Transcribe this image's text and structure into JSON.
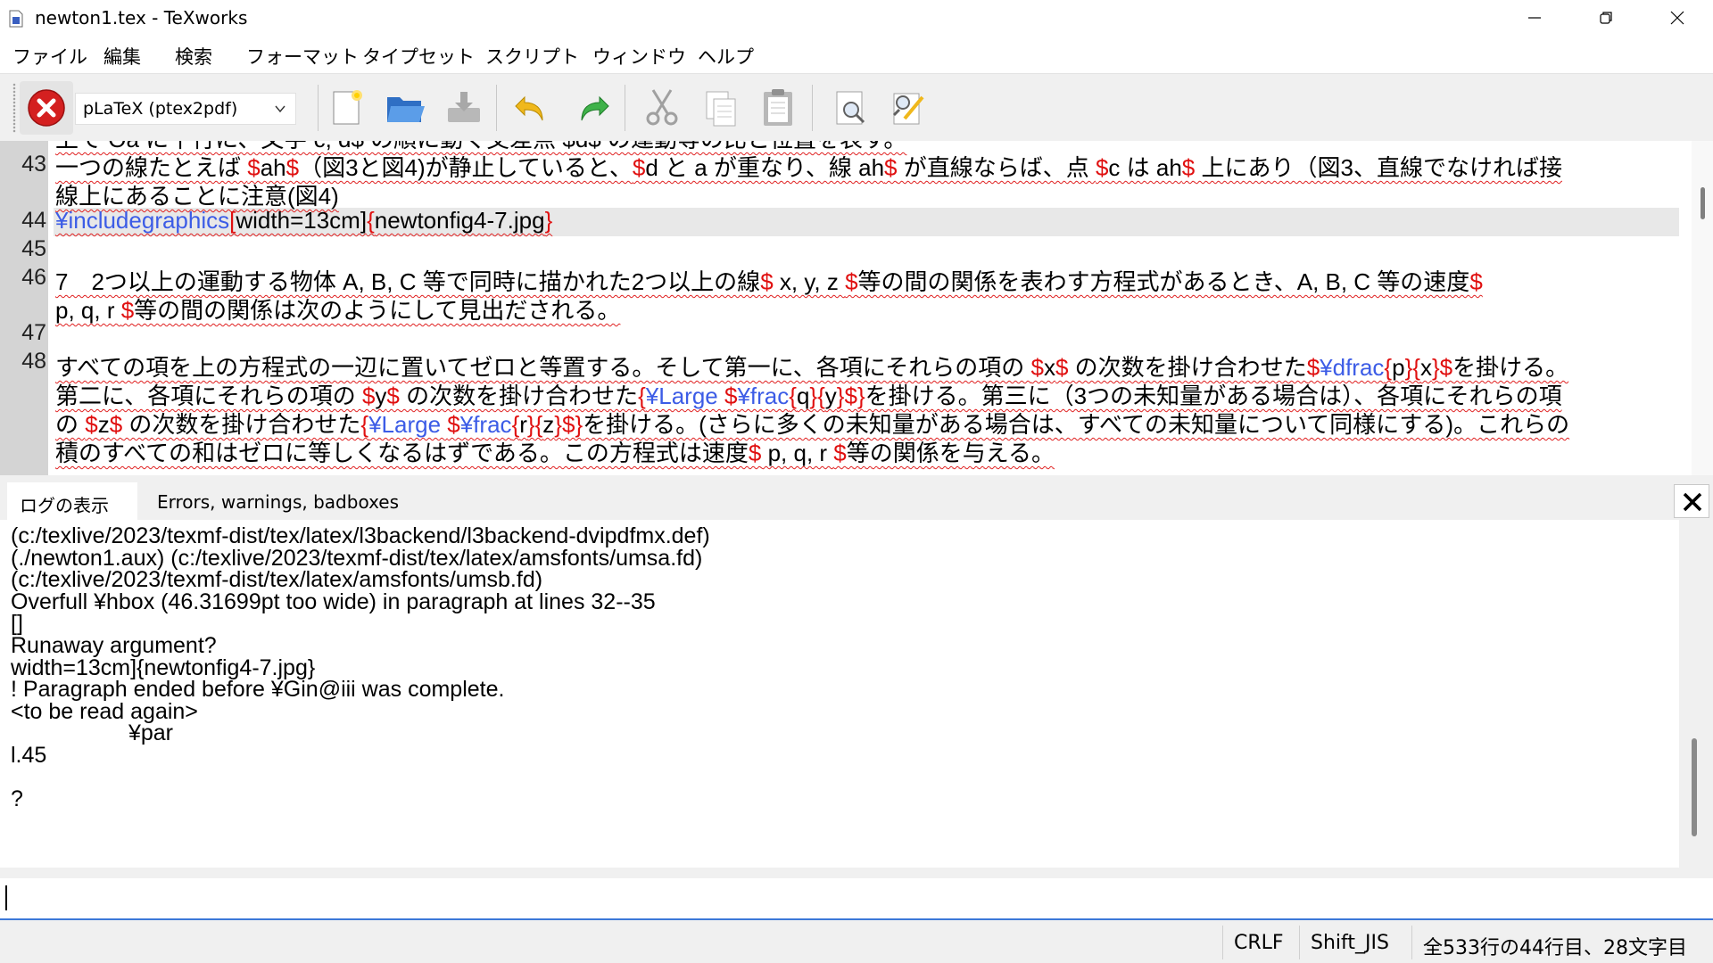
{
  "window": {
    "title": "newton1.tex - TeXworks"
  },
  "menu": [
    "ファイル",
    "編集",
    "検索",
    "フォーマット",
    "タイプセット",
    "スクリプト",
    "ウィンドウ",
    "ヘルプ"
  ],
  "toolbar": {
    "engine": "pLaTeX (ptex2pdf)",
    "icons": [
      "stop-typeset-icon",
      "new-document-icon",
      "open-folder-icon",
      "save-icon",
      "undo-icon",
      "redo-icon",
      "cut-icon",
      "copy-icon",
      "paste-icon",
      "find-icon",
      "replace-icon"
    ]
  },
  "editor": {
    "clipped_line": "上で Oa に平行に、文字 c, d$ の順に動く交差点 $d$ の運動等の比と位置を表す。",
    "line_numbers": [
      "43",
      "",
      "44",
      "45",
      "46",
      "",
      "47",
      "48",
      "",
      "",
      ""
    ],
    "lines": [
      [
        {
          "t": "一つの線たとえば ",
          "c": "n"
        },
        {
          "t": "$",
          "c": "r"
        },
        {
          "t": "ah",
          "c": "n"
        },
        {
          "t": "$",
          "c": "r"
        },
        {
          "t": "（図3と図4)が静止していると、",
          "c": "n"
        },
        {
          "t": "$",
          "c": "r"
        },
        {
          "t": "d と a が重なり、線 ah",
          "c": "n"
        },
        {
          "t": "$",
          "c": "r"
        },
        {
          "t": " が直線ならば、点 ",
          "c": "n"
        },
        {
          "t": "$",
          "c": "r"
        },
        {
          "t": "c は ah",
          "c": "n"
        },
        {
          "t": "$",
          "c": "r"
        },
        {
          "t": " 上にあり（図3、直線でなければ接",
          "c": "n"
        }
      ],
      [
        {
          "t": "線上にあることに注意(図4)",
          "c": "n"
        }
      ],
      [
        {
          "t": "¥includegraphics",
          "c": "b"
        },
        {
          "t": "[",
          "c": "r"
        },
        {
          "t": "width=13cm]",
          "c": "n"
        },
        {
          "t": "{",
          "c": "r"
        },
        {
          "t": "newtonfig4-7.jpg",
          "c": "n"
        },
        {
          "t": "}",
          "c": "r"
        }
      ],
      [],
      [
        {
          "t": "7　2つ以上の運動する物体 A, B, C 等で同時に描かれた2つ以上の線",
          "c": "n"
        },
        {
          "t": "$",
          "c": "r"
        },
        {
          "t": " x, y, z ",
          "c": "n"
        },
        {
          "t": "$",
          "c": "r"
        },
        {
          "t": "等の間の関係を表わす方程式があるとき、A, B, C 等の速度",
          "c": "n"
        },
        {
          "t": "$",
          "c": "r"
        }
      ],
      [
        {
          "t": "p, q, r ",
          "c": "n"
        },
        {
          "t": "$",
          "c": "r"
        },
        {
          "t": "等の間の関係は次のようにして見出だされる。",
          "c": "n"
        }
      ],
      [],
      [
        {
          "t": "すべての項を上の方程式の一辺に置いてゼロと等置する。そして第一に、各項にそれらの項の ",
          "c": "n"
        },
        {
          "t": "$",
          "c": "r"
        },
        {
          "t": "x",
          "c": "n"
        },
        {
          "t": "$",
          "c": "r"
        },
        {
          "t": " の次数を掛け合わせた",
          "c": "n"
        },
        {
          "t": "$",
          "c": "r"
        },
        {
          "t": "¥dfrac",
          "c": "b"
        },
        {
          "t": "{",
          "c": "r"
        },
        {
          "t": "p",
          "c": "n"
        },
        {
          "t": "}{",
          "c": "r"
        },
        {
          "t": "x",
          "c": "n"
        },
        {
          "t": "}",
          "c": "r"
        },
        {
          "t": "$",
          "c": "r"
        },
        {
          "t": "を掛ける。",
          "c": "n"
        }
      ],
      [
        {
          "t": "第二に、各項にそれらの項の ",
          "c": "n"
        },
        {
          "t": "$",
          "c": "r"
        },
        {
          "t": "y",
          "c": "n"
        },
        {
          "t": "$",
          "c": "r"
        },
        {
          "t": " の次数を掛け合わせた",
          "c": "n"
        },
        {
          "t": "{",
          "c": "r"
        },
        {
          "t": "¥Large ",
          "c": "b"
        },
        {
          "t": "$",
          "c": "r"
        },
        {
          "t": "¥frac",
          "c": "b"
        },
        {
          "t": "{",
          "c": "r"
        },
        {
          "t": "q",
          "c": "n"
        },
        {
          "t": "}{",
          "c": "r"
        },
        {
          "t": "y",
          "c": "n"
        },
        {
          "t": "}",
          "c": "r"
        },
        {
          "t": "$}",
          "c": "r"
        },
        {
          "t": "を掛ける。第三に（3つの未知量がある場合は）、各項にそれらの項",
          "c": "n"
        }
      ],
      [
        {
          "t": "の ",
          "c": "n"
        },
        {
          "t": "$",
          "c": "r"
        },
        {
          "t": "z",
          "c": "n"
        },
        {
          "t": "$",
          "c": "r"
        },
        {
          "t": " の次数を掛け合わせた",
          "c": "n"
        },
        {
          "t": "{",
          "c": "r"
        },
        {
          "t": "¥Large ",
          "c": "b"
        },
        {
          "t": "$",
          "c": "r"
        },
        {
          "t": "¥frac",
          "c": "b"
        },
        {
          "t": "{",
          "c": "r"
        },
        {
          "t": "r",
          "c": "n"
        },
        {
          "t": "}{",
          "c": "r"
        },
        {
          "t": "z",
          "c": "n"
        },
        {
          "t": "}",
          "c": "r"
        },
        {
          "t": "$}",
          "c": "r"
        },
        {
          "t": "を掛ける。(さらに多くの未知量がある場合は、すべての未知量について同様にする)。これらの",
          "c": "n"
        }
      ],
      [
        {
          "t": "積のすべての和はゼロに等しくなるはずである。この方程式は速度",
          "c": "n"
        },
        {
          "t": "$",
          "c": "r"
        },
        {
          "t": " p, q, r ",
          "c": "n"
        },
        {
          "t": "$",
          "c": "r"
        },
        {
          "t": "等の関係を与える。",
          "c": "n"
        }
      ]
    ]
  },
  "log": {
    "tabs": [
      "ログの表示",
      "Errors, warnings, badboxes"
    ],
    "lines": [
      "(c:/texlive/2023/texmf-dist/tex/latex/l3backend/l3backend-dvipdfmx.def)",
      "(./newton1.aux) (c:/texlive/2023/texmf-dist/tex/latex/amsfonts/umsa.fd)",
      "(c:/texlive/2023/texmf-dist/tex/latex/amsfonts/umsb.fd)",
      "Overfull ¥hbox (46.31699pt too wide) in paragraph at lines 32--35",
      "[]",
      "Runaway argument?",
      "width=13cm]{newtonfig4-7.jpg}",
      "! Paragraph ended before ¥Gin@iii was complete.",
      "<to be read again>",
      "                   ¥par",
      "l.45",
      "",
      "?"
    ]
  },
  "status": {
    "line_ending": "CRLF",
    "encoding": "Shift_JIS",
    "position": "全533行の44行目、28文字目"
  },
  "colors": {
    "dollar": "#e01010",
    "command": "#3c5ce6",
    "gutter": "#d4d4d4",
    "current_line": "#e8e8e8"
  }
}
